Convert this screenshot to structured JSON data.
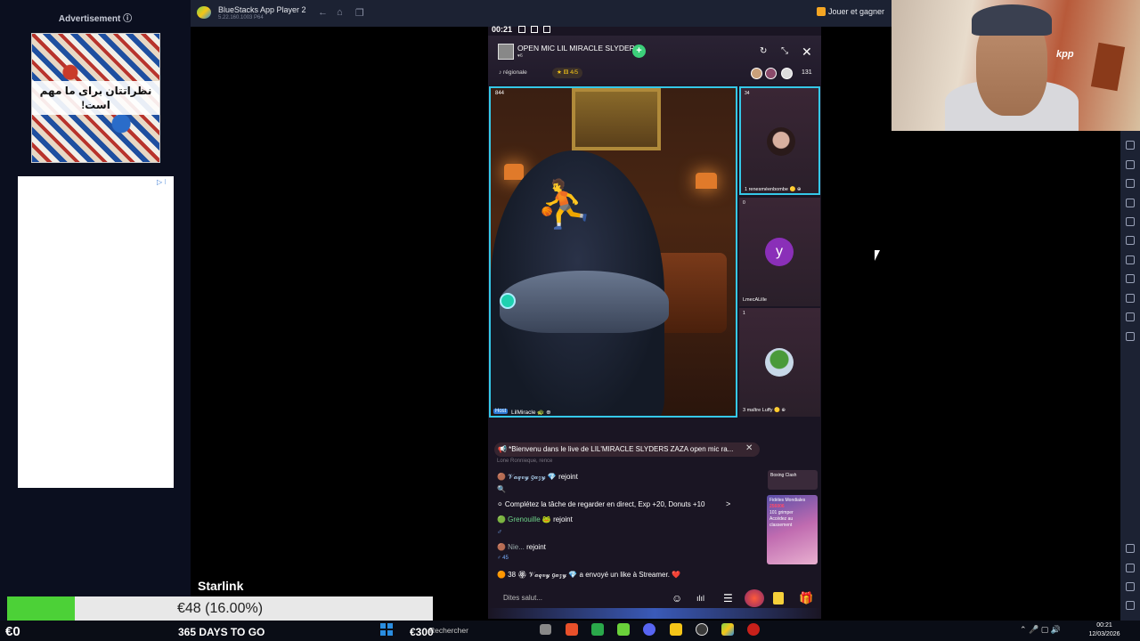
{
  "ad_panel": {
    "label": "Advertisement ⓘ",
    "image_text": "نظراتتان برای ما مهم است!",
    "choices": "▷ ⁝"
  },
  "bluestacks": {
    "title": "BlueStacks App Player 2",
    "version": "5.22.160.1003 P64",
    "nav_back": "←",
    "nav_home": "⌂",
    "nav_tabs": "❐",
    "earn_label": "Jouer et gagner"
  },
  "phone_status": {
    "time": "00:21"
  },
  "room": {
    "title": "OPEN MIC LIL MIRACLE SLYDER",
    "sub": "♥6",
    "follow": "+",
    "share_icon": "↻",
    "minimize_icon": "⤡",
    "close_icon": "✕",
    "region": "♪ régionale",
    "stars": "★ ⚅ 4/5",
    "viewer_count": "131"
  },
  "main_tile": {
    "count": "844",
    "host_badge": "Host",
    "host_name": "LilMiracle 🐢 ⊕"
  },
  "side_tiles": [
    {
      "count": "34",
      "name": "1  renesméenbombe 🟡 ⊕"
    },
    {
      "count": "0",
      "name": "LmecALille",
      "initial": "y"
    },
    {
      "count": "1",
      "name": "3  maître Luffy 🟡 ⊕"
    }
  ],
  "chat": {
    "welcome": "📢 *Bienvenu dans le live de  LIL'MIRACLE SLYDERS ZAZA  open mic ra...",
    "welcome_close": "✕",
    "faded": "Lone Ronnieque, rence",
    "msg1_name": "🟤 𝒱𝒶𝓆𝓋𝓎 𝑔𝒶𝓏𝓎 💎",
    "msg1_text": " rejoint",
    "msg2": "⚪ Complétez la tâche de regarder en direct, Exp +20, Donuts +10",
    "msg2_arrow": ">",
    "msg3_name": "🟢 Grenouille 🐸",
    "msg3_text": " rejoint",
    "msg3_badge": "♂",
    "msg4_name": "🟤 Nie...",
    "msg4_text": " rejoint",
    "msg4_badge": "♂ 45",
    "msg5": "🟠 38  🏵 𝒱𝒶𝓆𝓋𝓎 𝑔𝒶𝓏𝓎 💎 a envoyé un like à Streamer. ❤️",
    "input_placeholder": "Dites salut..."
  },
  "promos": {
    "promo1": "Boxing Clash",
    "promo2_title": "Fidèles Mondiales",
    "promo2_num": "256006",
    "promo2_text": "101 grimper",
    "promo2_footer": "Accédez au classement"
  },
  "bottom_icons": {
    "emoji": "☺",
    "audio": "ılıl",
    "menu": "☰",
    "gift": "🎁"
  },
  "donation": {
    "label": "Starlink",
    "progress_text": "€48 (16.00%)",
    "progress_fraction": 0.16,
    "left_amount": "€0",
    "days": "365 DAYS TO GO",
    "price": "€300"
  },
  "taskbar": {
    "search": "Rechercher",
    "tray": "⌃  🎤  ▢  🔊",
    "time": "00:21",
    "date": "12/03/2026"
  },
  "colors": {
    "accent_cyan": "#35c8e8",
    "progress_green": "#4cd137",
    "follow_green": "#3ccf7a"
  }
}
